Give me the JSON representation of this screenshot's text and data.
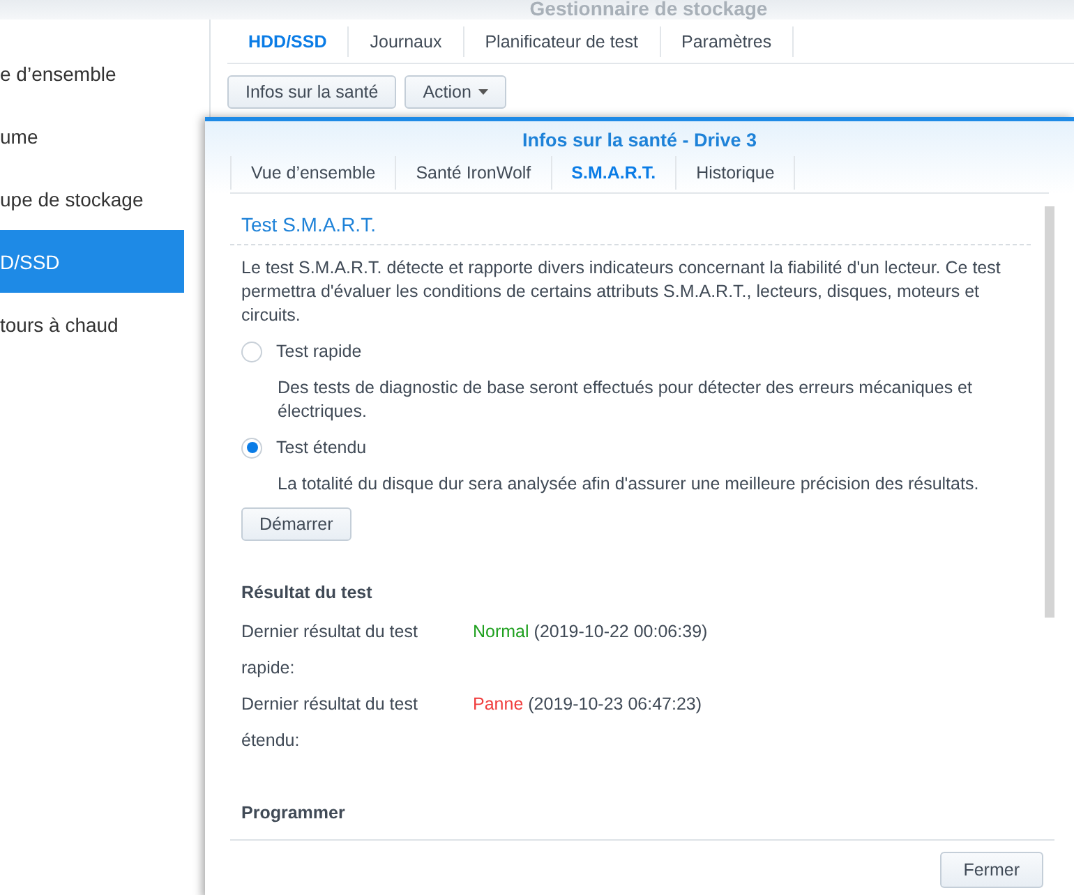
{
  "window": {
    "title": "Gestionnaire de stockage"
  },
  "sidebar": {
    "items": [
      {
        "label": "e d’ensemble",
        "selected": false
      },
      {
        "label": "ume",
        "selected": false
      },
      {
        "label": "upe de stockage",
        "selected": false
      },
      {
        "label": "D/SSD",
        "selected": true
      },
      {
        "label": "tours à chaud",
        "selected": false
      }
    ]
  },
  "tabs": [
    {
      "label": "HDD/SSD",
      "selected": true
    },
    {
      "label": "Journaux",
      "selected": false
    },
    {
      "label": "Planificateur de test",
      "selected": false
    },
    {
      "label": "Paramètres",
      "selected": false
    }
  ],
  "toolbar": [
    {
      "label": "Infos sur la santé",
      "kind": "button"
    },
    {
      "label": "Action",
      "kind": "menu"
    }
  ],
  "dialog": {
    "title": "Infos sur la santé - Drive 3",
    "tabs": [
      {
        "label": "Vue d’ensemble",
        "selected": false
      },
      {
        "label": "Santé IronWolf",
        "selected": false
      },
      {
        "label": "S.M.A.R.T.",
        "selected": true
      },
      {
        "label": "Historique",
        "selected": false
      }
    ],
    "section_title": "Test S.M.A.R.T.",
    "description": "Le test S.M.A.R.T. détecte et rapporte divers indicateurs concernant la fiabilité d'un lecteur. Ce test permettra d'évaluer les conditions de certains attributs S.M.A.R.T., lecteurs, disques, moteurs et circuits.",
    "options": [
      {
        "label": "Test rapide",
        "selected": false,
        "description": "Des tests de diagnostic de base seront effectués pour détecter des erreurs mécaniques et électriques."
      },
      {
        "label": "Test étendu",
        "selected": true,
        "description": "La totalité du disque dur sera analysée afin d'assurer une meilleure précision des résultats."
      }
    ],
    "start_button": "Démarrer",
    "results_title": "Résultat du test",
    "results": [
      {
        "label": "Dernier résultat du test rapide:",
        "status": "Normal",
        "color": "#1fa01f",
        "time": "(2019-10-22 00:06:39)"
      },
      {
        "label": "Dernier résultat du test étendu:",
        "status": "Panne",
        "color": "#f03c3c",
        "time": "(2019-10-23 06:47:23)"
      }
    ],
    "schedule_title": "Programmer",
    "close_button": "Fermer"
  }
}
